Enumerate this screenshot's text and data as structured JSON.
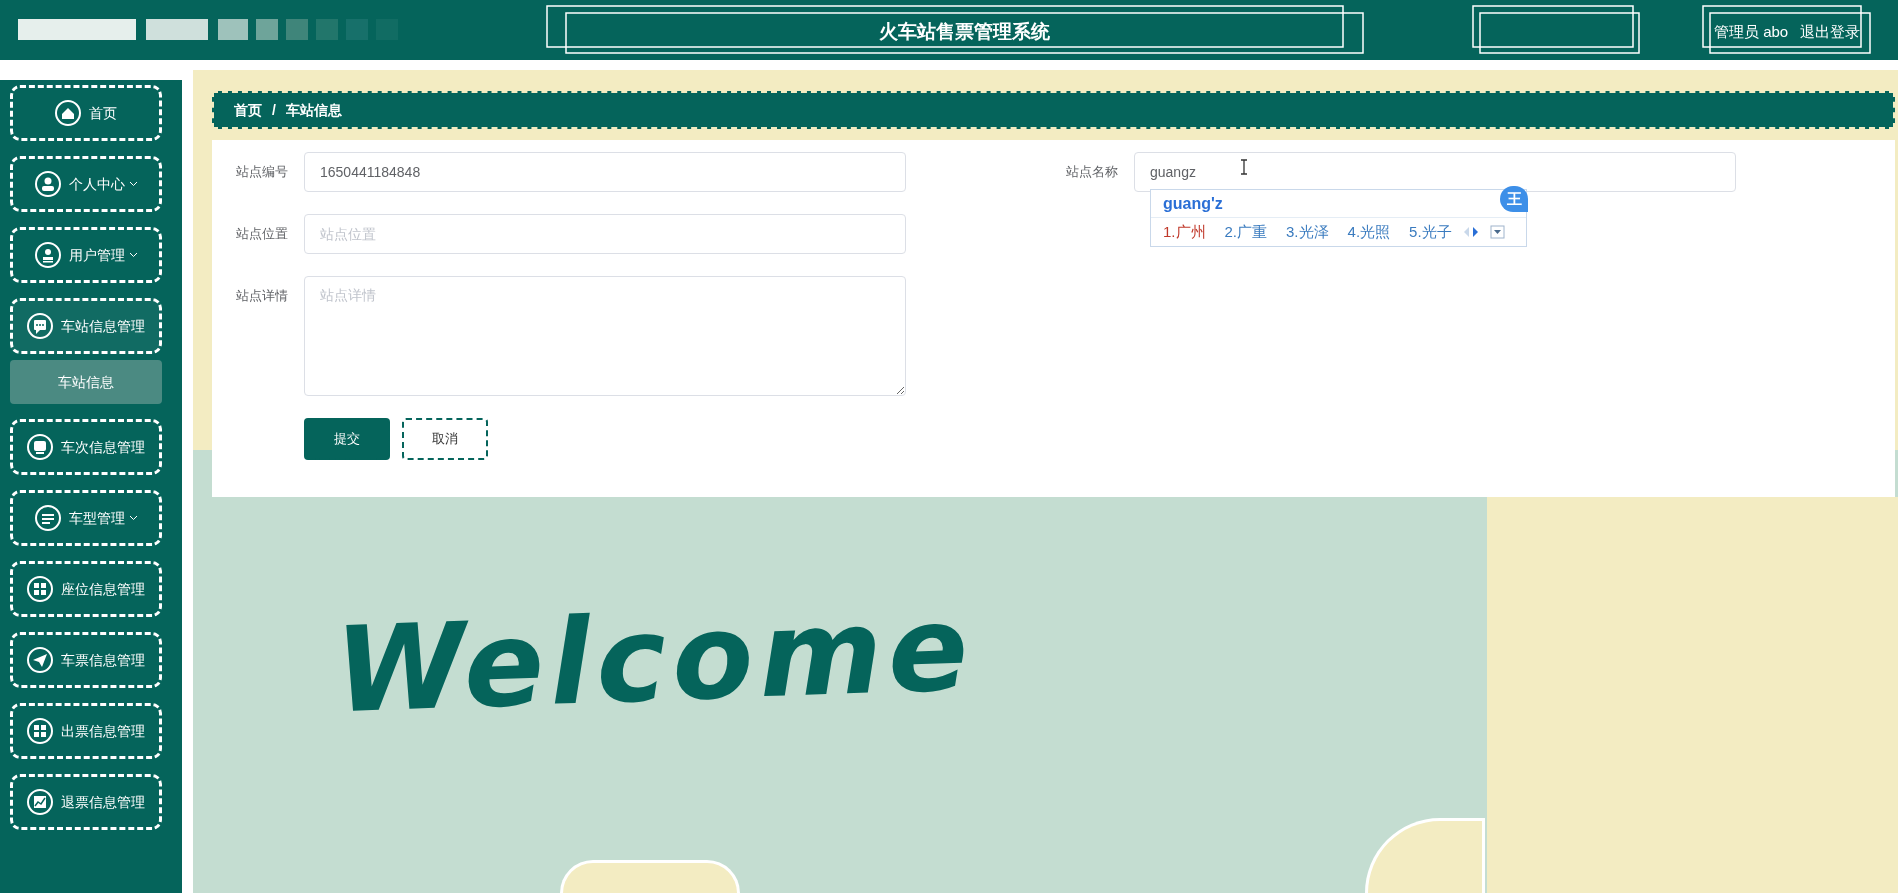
{
  "header": {
    "title": "火车站售票管理系统",
    "user": "管理员 abo",
    "logout": "退出登录"
  },
  "sidebar": {
    "items": [
      {
        "label": "首页",
        "has_arrow": false,
        "expanded": false
      },
      {
        "label": "个人中心",
        "has_arrow": true,
        "expanded": false
      },
      {
        "label": "用户管理",
        "has_arrow": true,
        "expanded": false
      },
      {
        "label": "车站信息管理",
        "has_arrow": false,
        "expanded": true,
        "children": [
          {
            "label": "车站信息",
            "selected": true
          }
        ]
      },
      {
        "label": "车次信息管理",
        "has_arrow": false,
        "expanded": false
      },
      {
        "label": "车型管理",
        "has_arrow": true,
        "expanded": false
      },
      {
        "label": "座位信息管理",
        "has_arrow": false,
        "expanded": false
      },
      {
        "label": "车票信息管理",
        "has_arrow": false,
        "expanded": false
      },
      {
        "label": "出票信息管理",
        "has_arrow": false,
        "expanded": false
      },
      {
        "label": "退票信息管理",
        "has_arrow": false,
        "expanded": false
      }
    ]
  },
  "breadcrumb": {
    "items": [
      "首页",
      "车站信息"
    ],
    "separator": "/"
  },
  "form": {
    "left": [
      {
        "label": "站点编号",
        "kind": "input",
        "value": "1650441184848"
      },
      {
        "label": "站点位置",
        "kind": "input",
        "placeholder": "站点位置"
      },
      {
        "label": "站点详情",
        "kind": "textarea",
        "placeholder": "站点详情"
      }
    ],
    "right": [
      {
        "label": "站点名称",
        "kind": "input",
        "value": "guangz"
      }
    ],
    "buttons": [
      {
        "label": "提交",
        "primary": true
      },
      {
        "label": "取消",
        "primary": false
      }
    ]
  },
  "ime": {
    "composition": "guang'z",
    "badge": "王",
    "candidates": [
      {
        "text": "1.广州",
        "selected": true
      },
      {
        "text": "2.广重",
        "selected": false
      },
      {
        "text": "3.光泽",
        "selected": false
      },
      {
        "text": "4.光照",
        "selected": false
      },
      {
        "text": "5.光子",
        "selected": false
      }
    ]
  },
  "welcome": "Welcome"
}
